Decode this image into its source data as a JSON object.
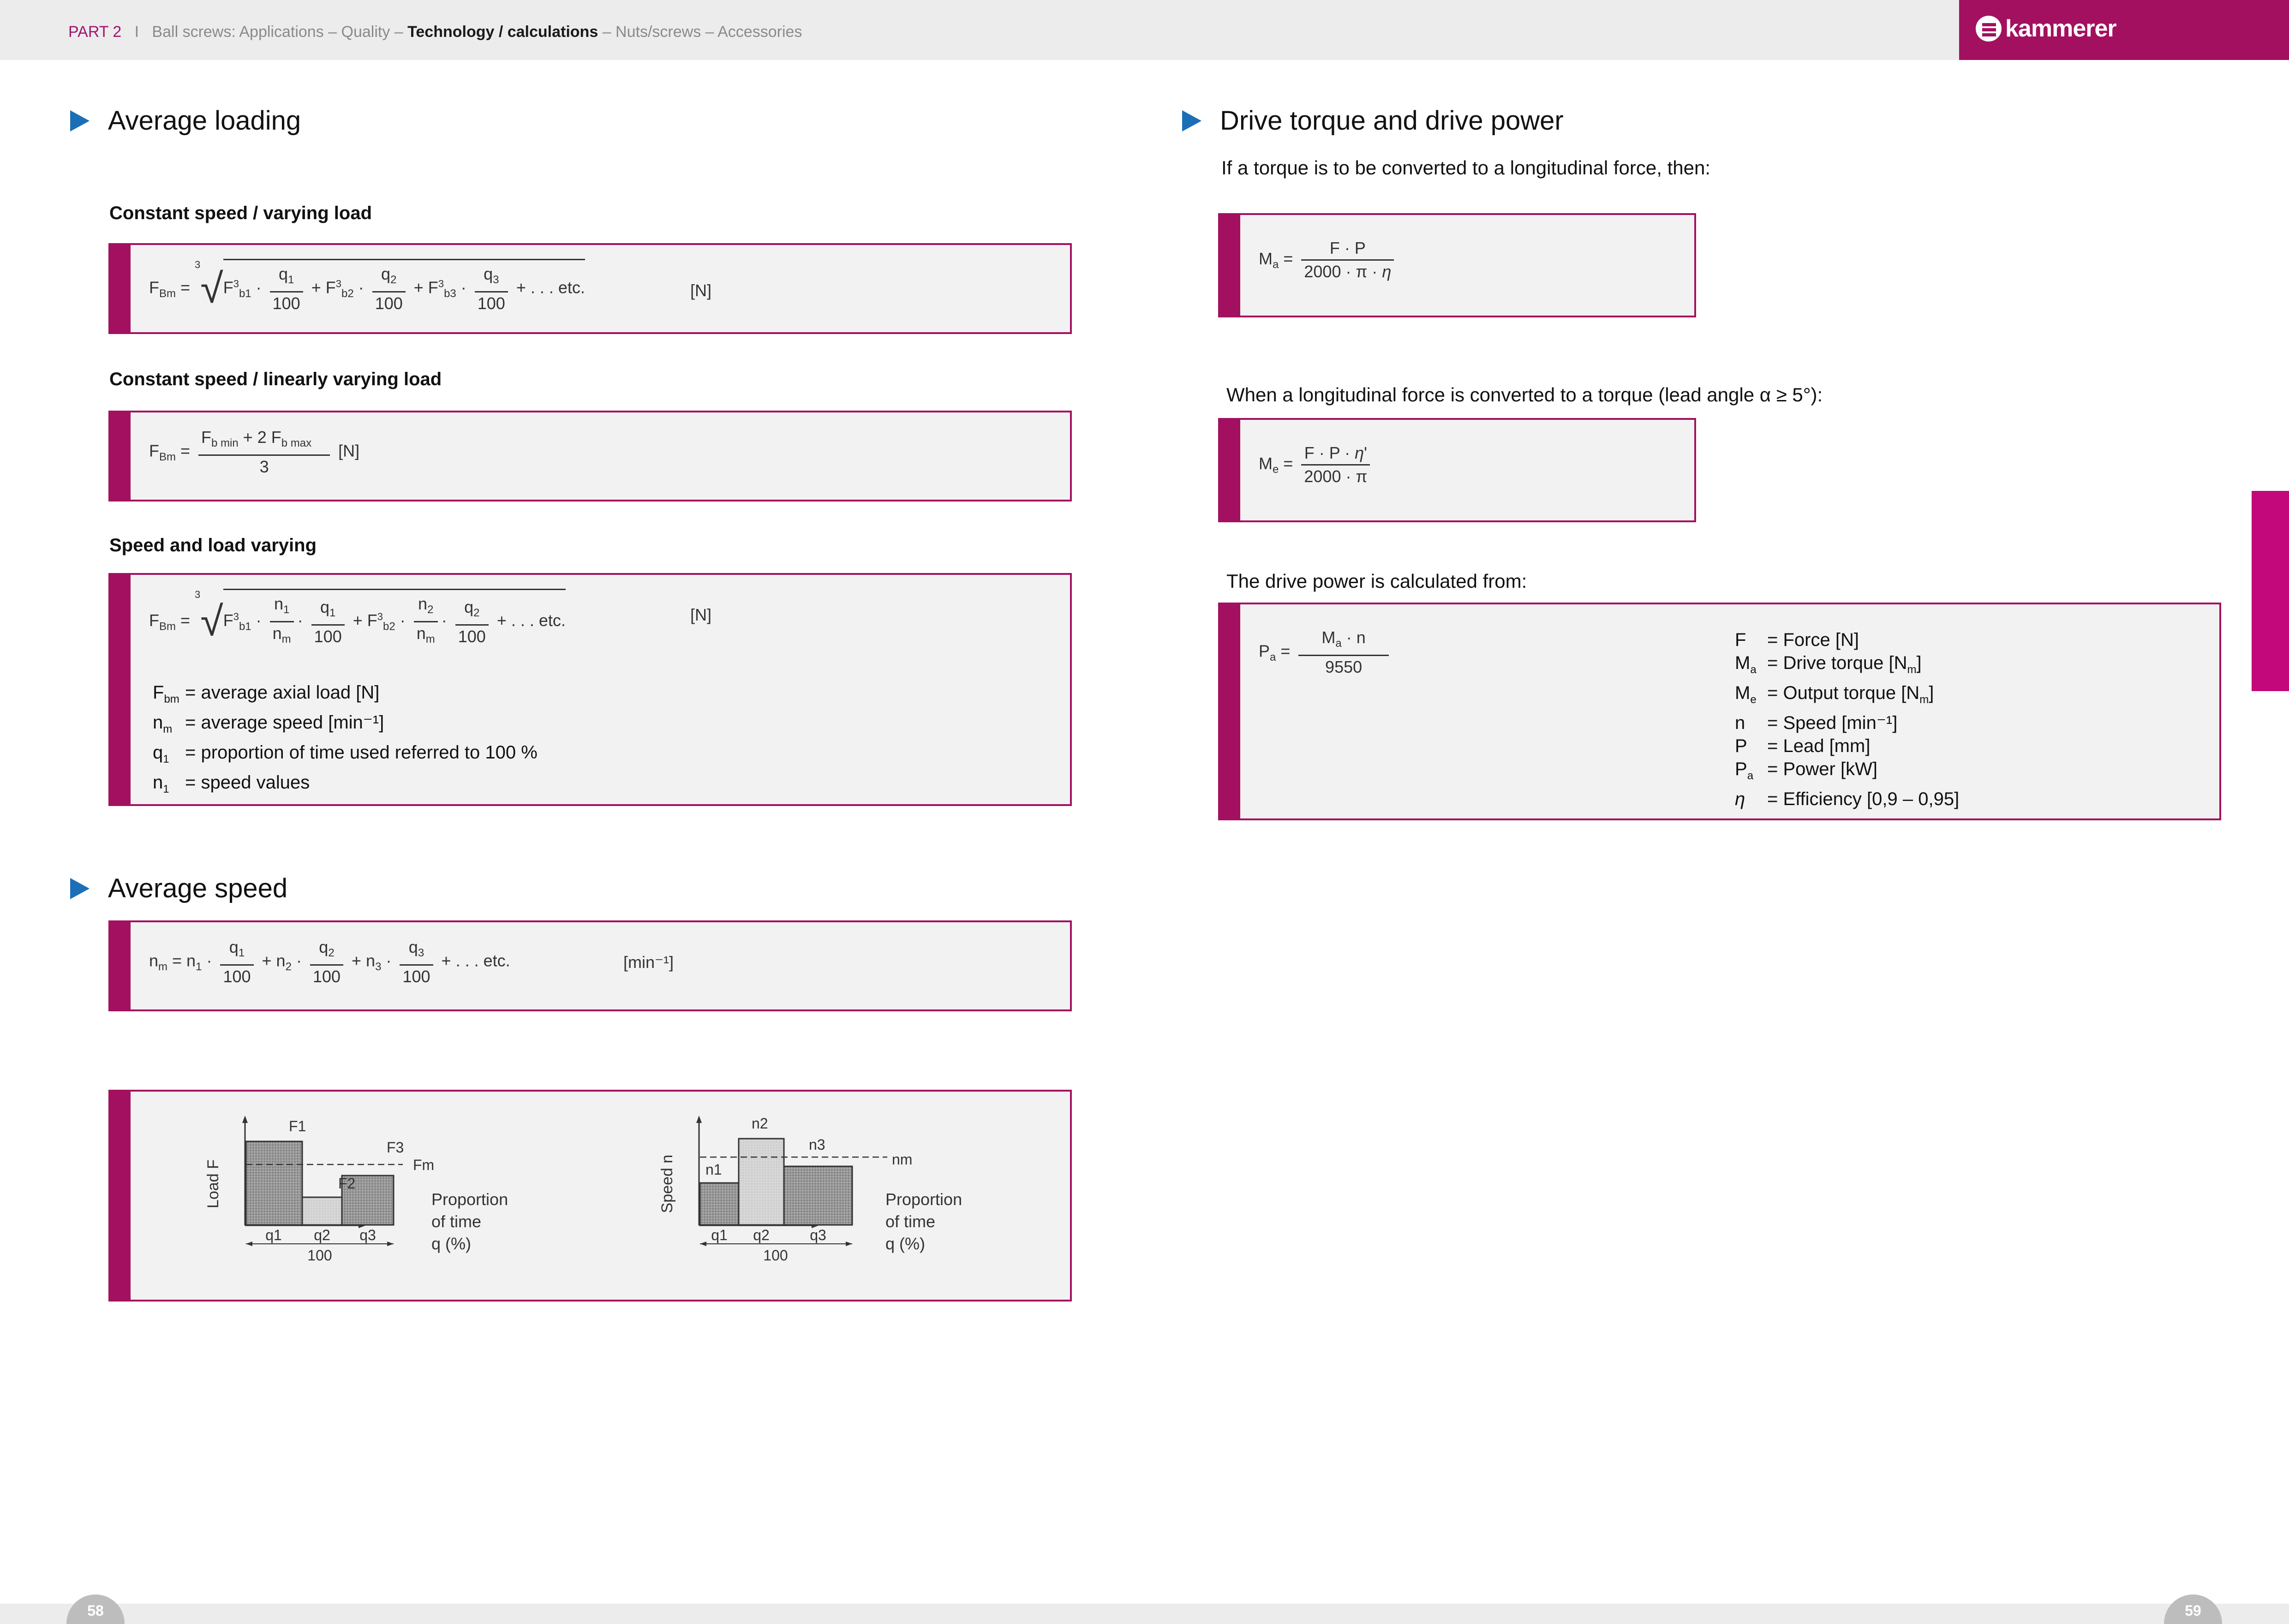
{
  "header": {
    "part": "PART 2",
    "sep": "I",
    "crumb_pre": "Ball screws: Applications – Quality –",
    "crumb_current": "Technology / calculations",
    "crumb_post": "– Nuts/screws – Accessories",
    "logo": "kammerer"
  },
  "left": {
    "average_loading": {
      "heading": "Average loading",
      "sub1": "Constant speed / varying load",
      "sub2": "Constant speed / linearly varying load",
      "sub3": "Speed and load varying",
      "unit_N": "[N]",
      "etc": "+ . . . etc.",
      "legend": [
        {
          "sym": "F",
          "sub": "bm",
          "text": "= average axial load [N]"
        },
        {
          "sym": "n",
          "sub": "m",
          "text": "= average speed [min⁻¹]"
        },
        {
          "sym": "q",
          "sub": "1",
          "text": "= proportion of time used referred to 100 %"
        },
        {
          "sym": "n",
          "sub": "1",
          "text": "= speed values"
        }
      ]
    },
    "average_speed": {
      "heading": "Average speed",
      "unit": "[min⁻¹]",
      "etc": "+ . . . etc."
    },
    "charts": {
      "load": {
        "ylabel": "Load F",
        "labels": [
          "F1",
          "F2",
          "F3",
          "Fm"
        ],
        "x_labels": [
          "q1",
          "q2",
          "q3"
        ],
        "total": "100",
        "side_label": [
          "Proportion",
          "of time",
          "q (%)"
        ]
      },
      "speed": {
        "ylabel": "Speed n",
        "labels": [
          "n1",
          "n2",
          "n3",
          "nm"
        ],
        "x_labels": [
          "q1",
          "q2",
          "q3"
        ],
        "total": "100",
        "side_label": [
          "Proportion",
          "of time",
          "q (%)"
        ]
      }
    }
  },
  "right": {
    "heading": "Drive torque and drive power",
    "intro": "If a torque is to be converted to a longitudinal force, then:",
    "torque_to_force_text": "When a longitudinal force is converted to a torque (lead angle α ≥ 5°):",
    "power_text": "The drive power is calculated from:",
    "legend": [
      {
        "sym": "F",
        "sub": "",
        "text": "= Force [N]"
      },
      {
        "sym": "M",
        "sub": "a",
        "text": "= Drive torque [N",
        "tail_sub": "m",
        "tail": "]"
      },
      {
        "sym": "M",
        "sub": "e",
        "text": "= Output torque [N",
        "tail_sub": "m",
        "tail": "]"
      },
      {
        "sym": "n",
        "sub": "",
        "text": "= Speed [min⁻¹]"
      },
      {
        "sym": "P",
        "sub": "",
        "text": "= Lead [mm]"
      },
      {
        "sym": "P",
        "sub": "a",
        "text": "= Power [kW]"
      },
      {
        "sym": "η",
        "sub": "",
        "text": "= Efficiency [0,9 – 0,95]"
      }
    ]
  },
  "footer": {
    "page_left": "58",
    "page_right": "59"
  }
}
